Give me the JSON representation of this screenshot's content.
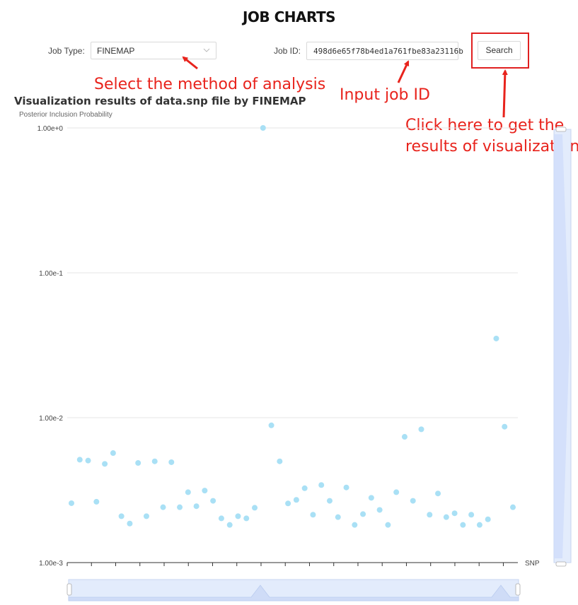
{
  "page": {
    "title": "JOB CHARTS"
  },
  "form": {
    "job_type_label": "Job Type:",
    "job_type_value": "FINEMAP",
    "job_id_label": "Job ID:",
    "job_id_value": "498d6e65f78b4ed1a761fbe83a23116b",
    "search_label": "Search"
  },
  "annotations": {
    "select_method": "Select the method of analysis",
    "input_id": "Input job ID",
    "click_line1": "Click here to get the",
    "click_line2": "results of visualization"
  },
  "colors": {
    "point": "#a9e0f5",
    "annotation": "#e8231c",
    "zoom": "#d6e2fb"
  },
  "chart_data": {
    "type": "scatter",
    "title": "Visualization results of data.snp file by FINEMAP",
    "ylabel": "Posterior Inclusion Probability",
    "xlabel": "SNP",
    "y_scale": "log",
    "ylim": [
      0.001,
      1
    ],
    "y_ticks": [
      "1.00e-3",
      "1.00e-2",
      "1.00e-1",
      "1.00e+0"
    ],
    "grid": true,
    "values": [
      0.00257,
      0.00513,
      0.00506,
      0.00263,
      0.0048,
      0.0057,
      0.00209,
      0.00186,
      0.00487,
      0.00209,
      0.005,
      0.00241,
      0.00493,
      0.00241,
      0.00306,
      0.00245,
      0.00314,
      0.00267,
      0.00202,
      0.00182,
      0.00209,
      0.00202,
      0.00239,
      1.0,
      0.00886,
      0.005,
      0.00256,
      0.00271,
      0.00326,
      0.00214,
      0.00343,
      0.00267,
      0.00206,
      0.0033,
      0.00182,
      0.00216,
      0.0028,
      0.00231,
      0.00182,
      0.00306,
      0.00738,
      0.00267,
      0.00832,
      0.00214,
      0.003,
      0.00206,
      0.00219,
      0.00182,
      0.00214,
      0.00182,
      0.00199,
      0.0352,
      0.00867,
      0.00241
    ]
  }
}
